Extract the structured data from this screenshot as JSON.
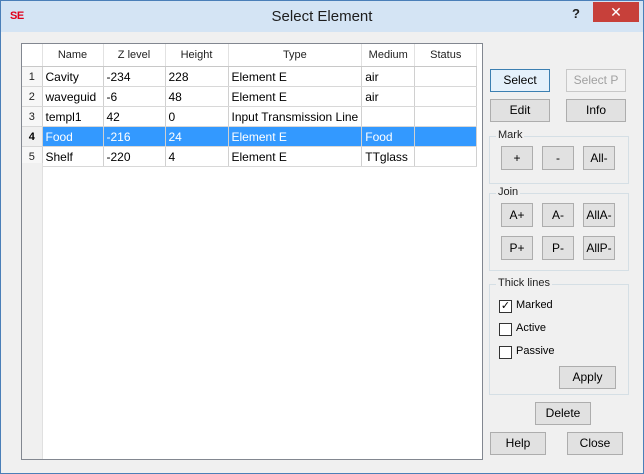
{
  "window": {
    "app_icon": "SE",
    "title": "Select Element",
    "help_glyph": "?",
    "close_glyph": "✕"
  },
  "table": {
    "columns": [
      "Name",
      "Z level",
      "Height",
      "Type",
      "Medium",
      "Status"
    ],
    "rows": [
      {
        "num": "1",
        "name": "Cavity",
        "z": "-234",
        "height": "228",
        "type": "Element E",
        "medium": "air",
        "status": ""
      },
      {
        "num": "2",
        "name": "waveguid",
        "z": "-6",
        "height": "48",
        "type": "Element E",
        "medium": "air",
        "status": ""
      },
      {
        "num": "3",
        "name": "templ1",
        "z": "42",
        "height": "0",
        "type": "Input Transmission Line",
        "medium": "",
        "status": ""
      },
      {
        "num": "4",
        "name": "Food",
        "z": "-216",
        "height": "24",
        "type": "Element E",
        "medium": "Food",
        "status": ""
      },
      {
        "num": "5",
        "name": "Shelf",
        "z": "-220",
        "height": "4",
        "type": "Element E",
        "medium": "TTglass",
        "status": ""
      }
    ],
    "selected_row": "4"
  },
  "buttons": {
    "select": "Select",
    "select_p": "Select P",
    "edit": "Edit",
    "info": "Info",
    "delete": "Delete",
    "help": "Help",
    "close": "Close"
  },
  "mark": {
    "label": "Mark",
    "plus": "+",
    "minus": "-",
    "all_minus": "All-"
  },
  "join": {
    "label": "Join",
    "a_plus": "A+",
    "a_minus": "A-",
    "all_a_minus": "AllA-",
    "p_plus": "P+",
    "p_minus": "P-",
    "all_p_minus": "AllP-"
  },
  "thick_lines": {
    "label": "Thick lines",
    "marked": {
      "label": "Marked",
      "checked": "✓"
    },
    "active": {
      "label": "Active",
      "checked": ""
    },
    "passive": {
      "label": "Passive",
      "checked": ""
    },
    "apply": "Apply"
  },
  "colors": {
    "selection": "#3399ff",
    "title_bar": "#d4e4f4",
    "close_button": "#c7403a"
  }
}
